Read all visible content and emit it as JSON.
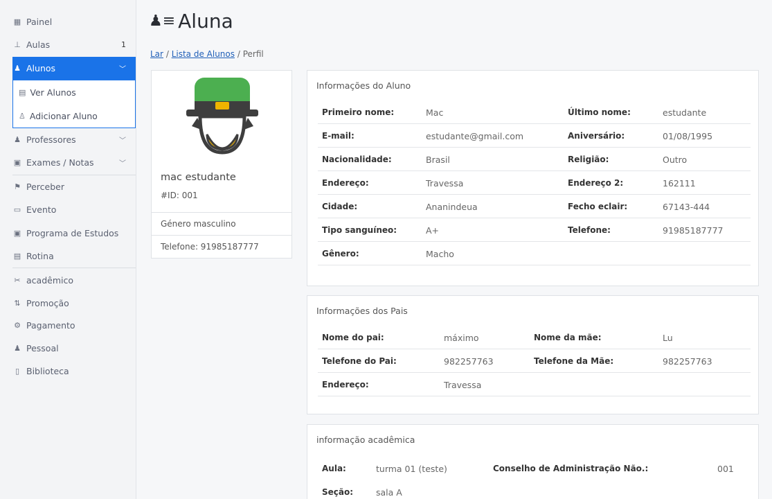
{
  "sidebar": {
    "items": [
      {
        "icon": "dashboard-icon",
        "label": "Painel"
      },
      {
        "icon": "classes-icon",
        "label": "Aulas",
        "badge": "1"
      },
      {
        "icon": "students-icon",
        "label": "Alunos",
        "active": true
      },
      {
        "icon": "teachers-icon",
        "label": "Professores"
      },
      {
        "icon": "exams-icon",
        "label": "Exames / Notas"
      },
      {
        "icon": "notice-icon",
        "label": "Perceber"
      },
      {
        "icon": "calendar-icon",
        "label": "Evento"
      },
      {
        "icon": "syllabus-icon",
        "label": "Programa de Estudos"
      },
      {
        "icon": "routine-icon",
        "label": "Rotina"
      },
      {
        "icon": "academic-icon",
        "label": "acadêmico"
      },
      {
        "icon": "promotion-icon",
        "label": "Promoção"
      },
      {
        "icon": "payment-icon",
        "label": "Pagamento"
      },
      {
        "icon": "staff-icon",
        "label": "Pessoal"
      },
      {
        "icon": "library-icon",
        "label": "Biblioteca"
      }
    ],
    "submenu": [
      {
        "icon": "list-icon",
        "label": "Ver Alunos"
      },
      {
        "icon": "add-user-icon",
        "label": "Adicionar Aluno"
      }
    ]
  },
  "header": {
    "title": "Aluna",
    "breadcrumb": {
      "home": "Lar",
      "sep1": "/",
      "list": "Lista de Alunos",
      "sep2": "/",
      "current": "Perfil"
    }
  },
  "profile": {
    "name": "mac estudante",
    "id": "#ID: 001",
    "gender": "Género masculino",
    "phone": "Telefone: 91985187777"
  },
  "student_info": {
    "title": "Informações do Aluno",
    "rows": [
      {
        "l1": "Primeiro nome:",
        "v1": "Mac",
        "l2": "Último nome:",
        "v2": "estudante"
      },
      {
        "l1": "E-mail:",
        "v1": "estudante@gmail.com",
        "l2": "Aniversário:",
        "v2": "01/08/1995"
      },
      {
        "l1": "Nacionalidade:",
        "v1": "Brasil",
        "l2": "Religião:",
        "v2": "Outro"
      },
      {
        "l1": "Endereço:",
        "v1": "Travessa",
        "l2": "Endereço 2:",
        "v2": "162111"
      },
      {
        "l1": "Cidade:",
        "v1": "Ananindeua",
        "l2": "Fecho eclair:",
        "v2": "67143-444"
      },
      {
        "l1": "Tipo sanguíneo:",
        "v1": "A+",
        "l2": "Telefone:",
        "v2": "91985187777"
      },
      {
        "l1": "Gênero:",
        "v1": "Macho",
        "l2": "",
        "v2": ""
      }
    ]
  },
  "parent_info": {
    "title": "Informações dos Pais",
    "rows": [
      {
        "l1": "Nome do pai:",
        "v1": "máximo",
        "l2": "Nome da mãe:",
        "v2": "Lu"
      },
      {
        "l1": "Telefone do Pai:",
        "v1": "982257763",
        "l2": "Telefone da Mãe:",
        "v2": "982257763"
      },
      {
        "l1": "Endereço:",
        "v1": "Travessa",
        "l2": "",
        "v2": ""
      }
    ]
  },
  "academic_info": {
    "title": "informação acadêmica",
    "rows": [
      {
        "l1": "Aula:",
        "v1": "turma 01 (teste)",
        "l2": "Conselho de Administração Não.:",
        "v2": "001"
      },
      {
        "l1": "Seção:",
        "v1": "sala A",
        "l2": "",
        "v2": ""
      }
    ]
  },
  "colors": {
    "accent": "#1a73e8",
    "hat": "#4caf50",
    "beard": "#f0b400"
  }
}
